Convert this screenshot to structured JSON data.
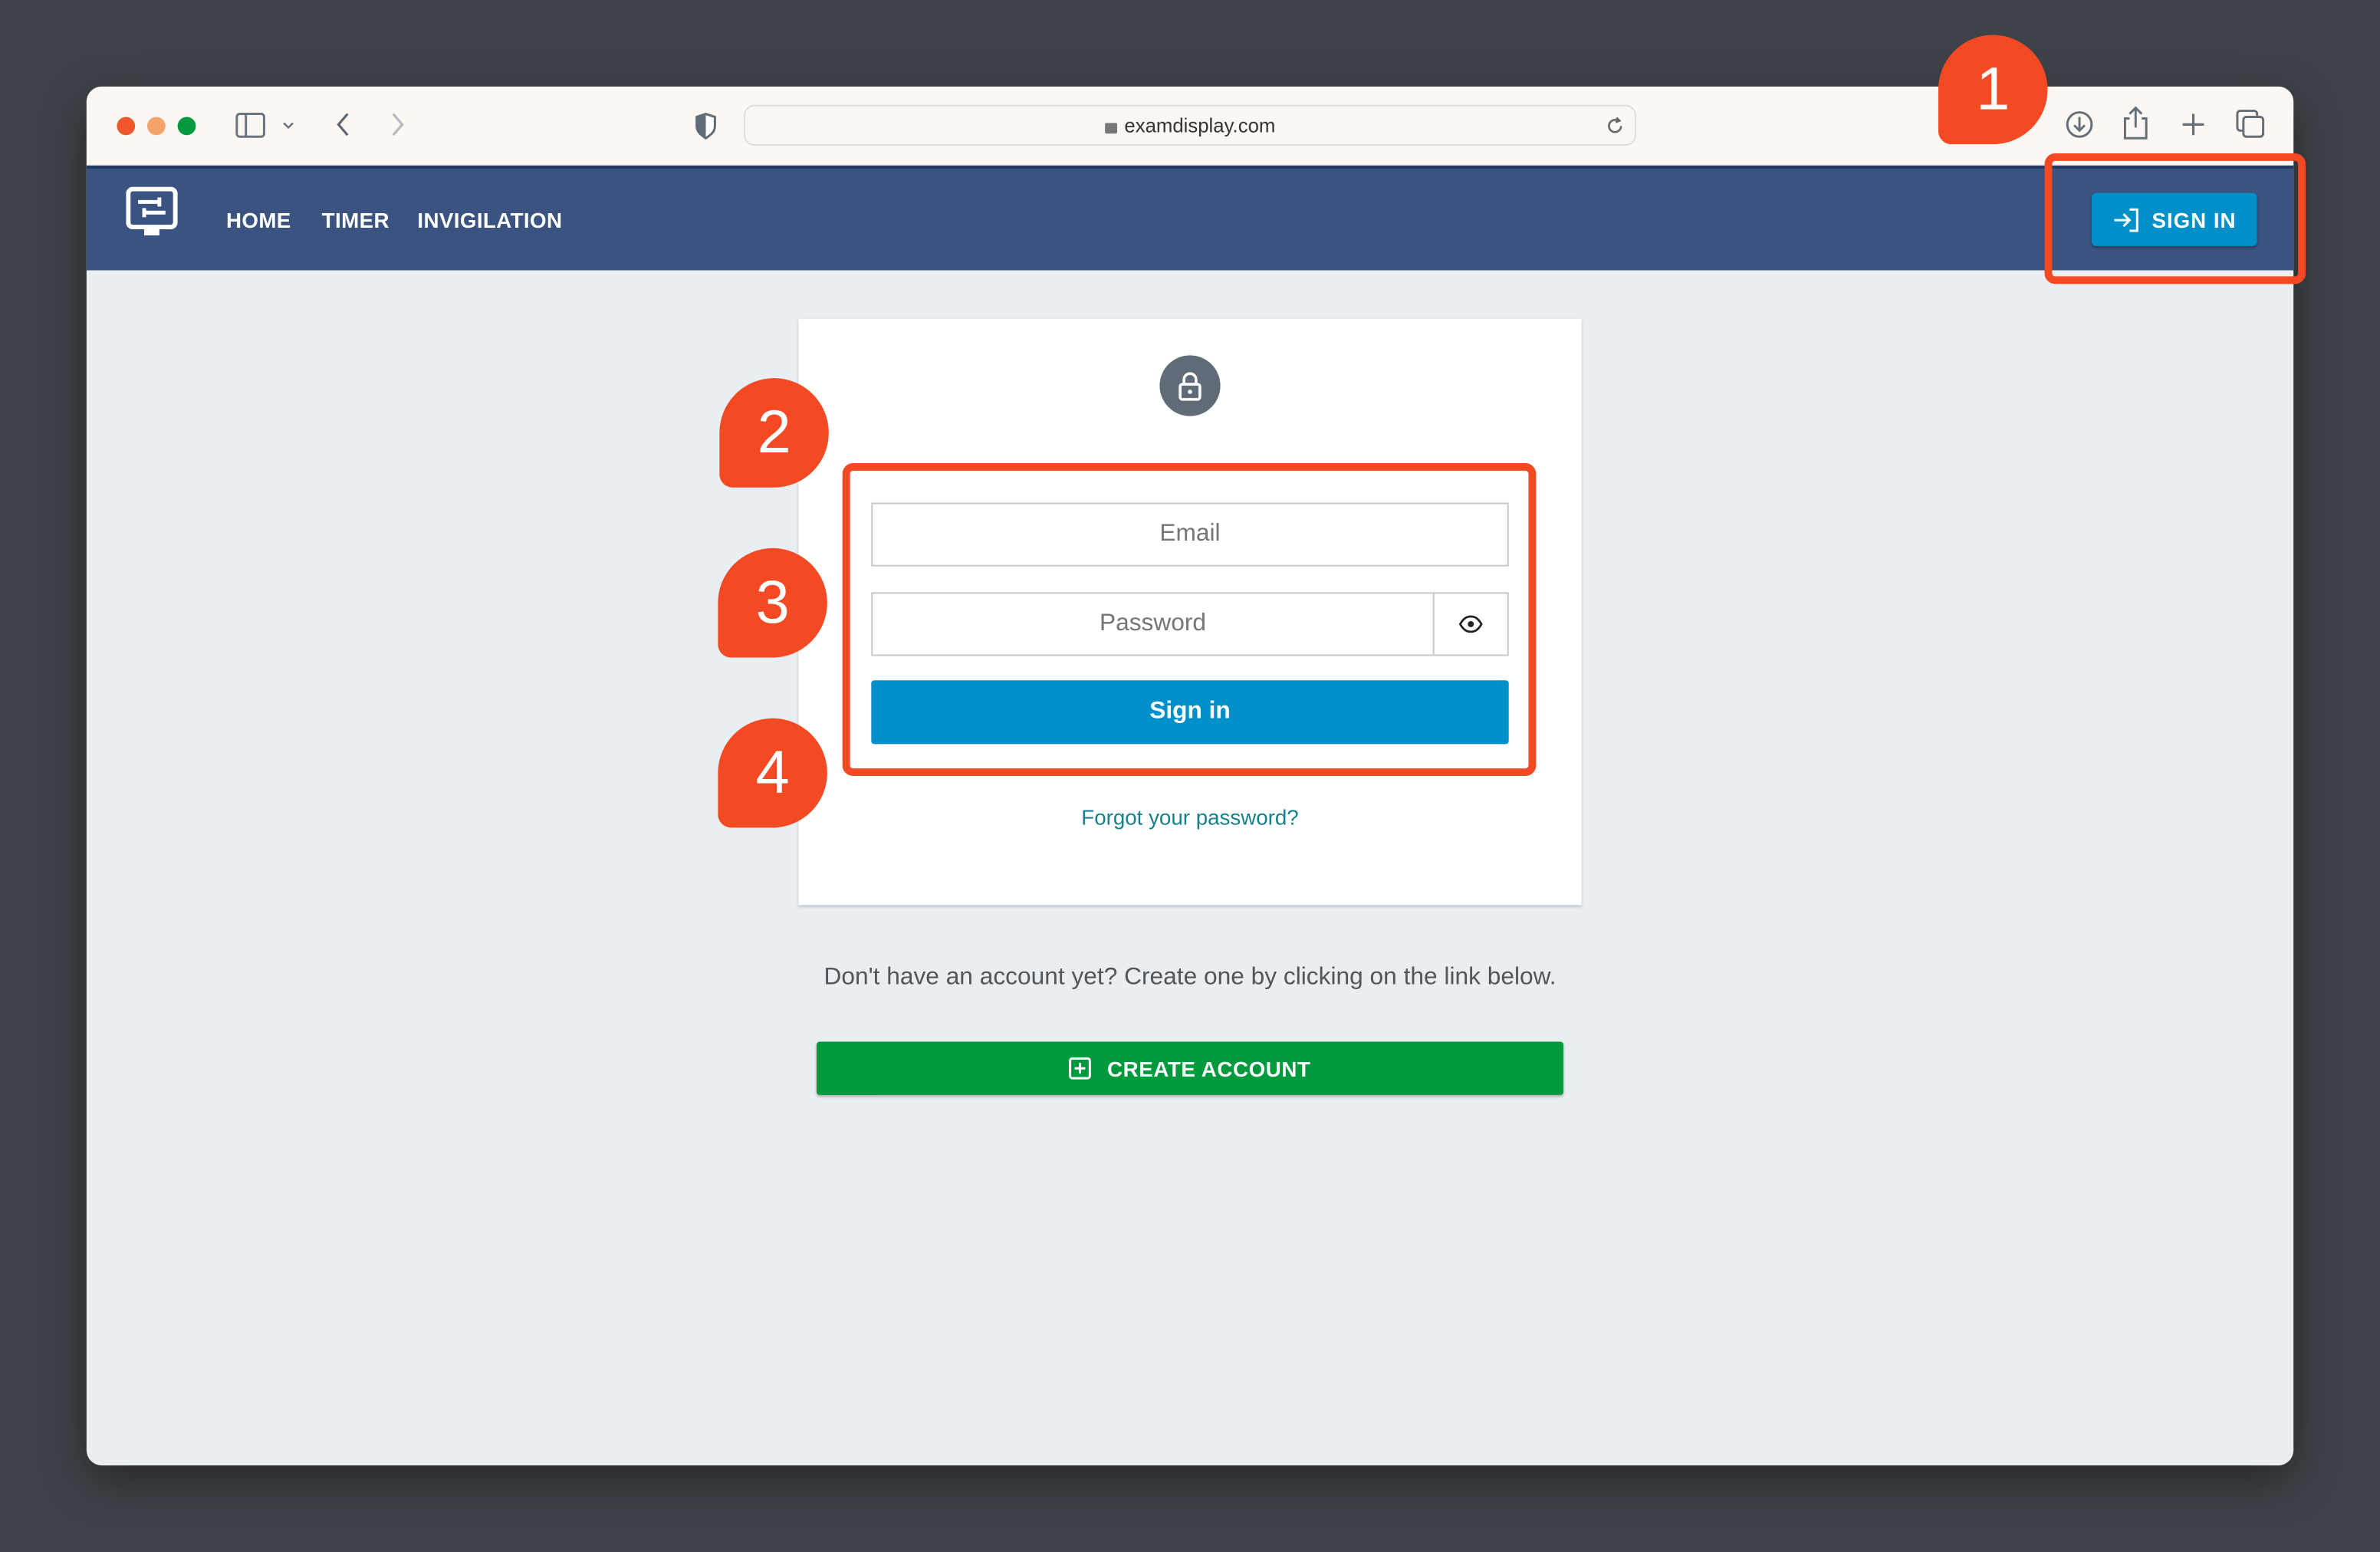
{
  "browser": {
    "url": "examdisplay.com",
    "traffic_lights": [
      "#f0582c",
      "#f5a36b",
      "#03993f"
    ]
  },
  "nav": {
    "links": [
      "HOME",
      "TIMER",
      "INVIGILATION"
    ],
    "sign_in_label": "SIGN IN",
    "color": "#3a5380"
  },
  "login": {
    "email_placeholder": "Email",
    "password_placeholder": "Password",
    "submit_label": "Sign in",
    "forgot_label": "Forgot your password?"
  },
  "signup": {
    "note": "Don't have an account yet? Create one by clicking on the link below.",
    "button_label": "CREATE ACCOUNT"
  },
  "annotations": {
    "markers": [
      "1",
      "2",
      "3",
      "4"
    ],
    "color": "#f34a24"
  }
}
